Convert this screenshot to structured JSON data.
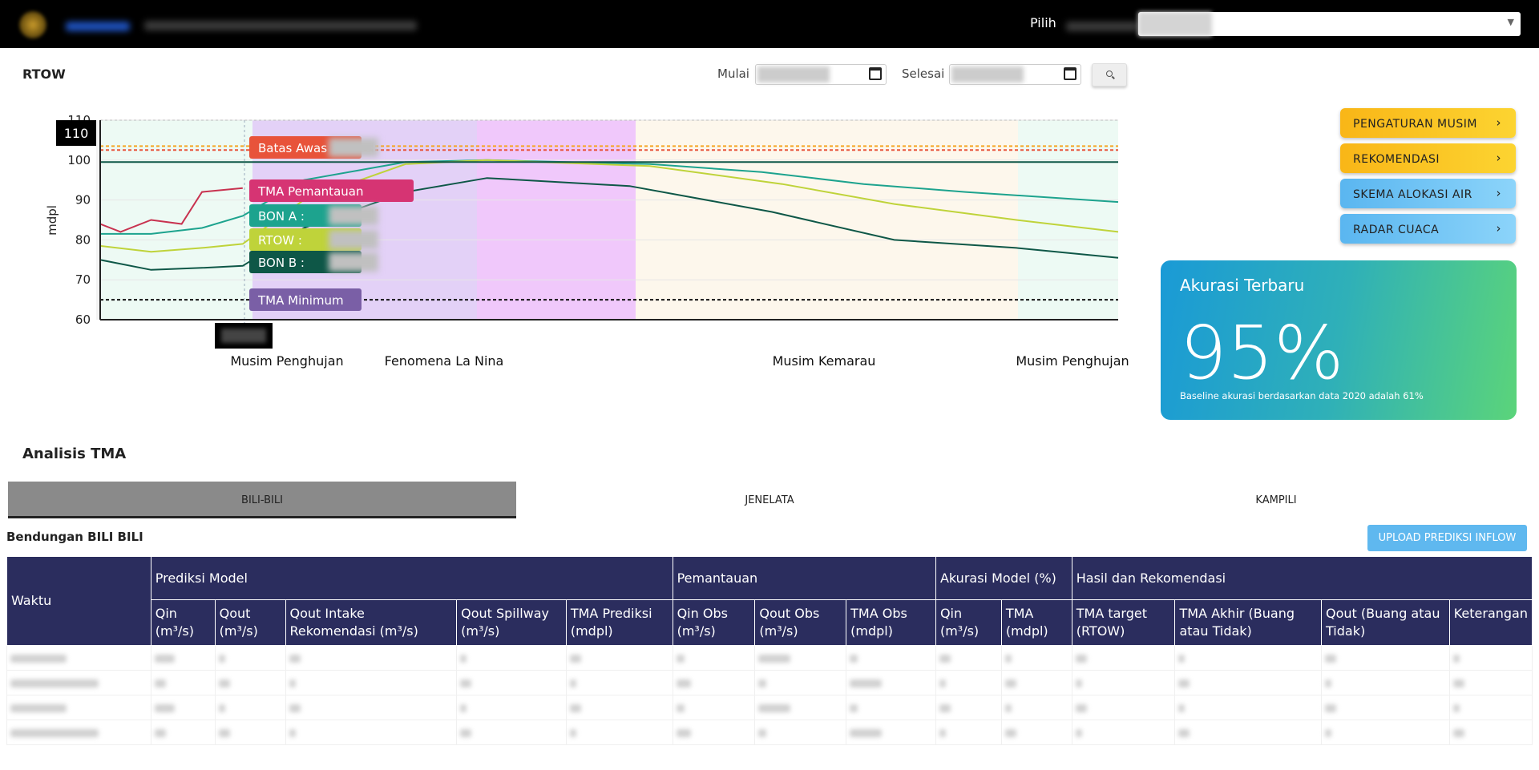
{
  "topbar": {
    "pilih_label": "Pilih"
  },
  "filter": {
    "title": "RTOW",
    "mulai_label": "Mulai",
    "selesai_label": "Selesai"
  },
  "chart_data": {
    "type": "line",
    "ylabel": "mdpl",
    "ylim": [
      60,
      110
    ],
    "y_ticks": [
      "110",
      "100",
      "90",
      "80",
      "70",
      "60"
    ],
    "hover_value": "110",
    "season_labels": [
      "Musim Penghujan",
      "Fenomena La Nina",
      "Musim Kemarau",
      "Musim Penghujan"
    ],
    "tooltips": [
      {
        "label": "Batas Awas",
        "color": "#e8533a"
      },
      {
        "label": "TMA Pemantauan",
        "color": "#d63473"
      },
      {
        "label": "BON A : ",
        "color": "#1da38e"
      },
      {
        "label": "RTOW : ",
        "color": "#bfd33a"
      },
      {
        "label": "BON B : ",
        "color": "#0e5747"
      },
      {
        "label": "TMA Minimum",
        "color": "#7a5fa6"
      }
    ],
    "series": [
      {
        "color": "#c8324f",
        "x": [
          0,
          0.02,
          0.05,
          0.08,
          0.1,
          0.14
        ],
        "values": [
          84,
          82,
          85,
          84,
          92,
          93
        ]
      },
      {
        "color": "#1da38e",
        "x": [
          0,
          0.05,
          0.1,
          0.14,
          0.2,
          0.3,
          0.38,
          0.54,
          0.65,
          0.75,
          0.85,
          1.0
        ],
        "values": [
          81.5,
          81.5,
          83,
          86,
          95,
          99.5,
          100,
          99,
          97,
          94,
          92,
          89.5
        ]
      },
      {
        "color": "#bfd33a",
        "x": [
          0,
          0.05,
          0.1,
          0.14,
          0.2,
          0.3,
          0.38,
          0.54,
          0.67,
          0.78,
          0.9,
          1.0
        ],
        "values": [
          78.5,
          77,
          78,
          79,
          90,
          99,
          100,
          98.5,
          94,
          89,
          85,
          82
        ]
      },
      {
        "color": "#0e5747",
        "x": [
          0,
          0.05,
          0.1,
          0.14,
          0.2,
          0.3,
          0.38,
          0.52,
          0.66,
          0.78,
          0.9,
          1.0
        ],
        "values": [
          75,
          72.5,
          73,
          73.5,
          83,
          92,
          95.5,
          93.5,
          87,
          80,
          78,
          75.5
        ]
      },
      {
        "color": "#111111",
        "dashed": true,
        "x": [
          0,
          1
        ],
        "values": [
          65,
          65
        ]
      },
      {
        "color": "#e8533a",
        "dashed": true,
        "x": [
          0,
          1
        ],
        "values": [
          102.5,
          102.5
        ]
      },
      {
        "color": "#f5a623",
        "dashed": true,
        "x": [
          0,
          1
        ],
        "values": [
          103.5,
          103.5
        ]
      },
      {
        "color": "#0e5747",
        "x": [
          0,
          1
        ],
        "values": [
          99.5,
          99.5
        ]
      }
    ]
  },
  "sidebar": {
    "buttons": [
      {
        "label": "PENGATURAN MUSIM",
        "chevron": "›"
      },
      {
        "label": "REKOMENDASI",
        "chevron": "›"
      },
      {
        "label": "SKEMA ALOKASI AIR",
        "chevron": "›"
      },
      {
        "label": "RADAR CUACA",
        "chevron": "›"
      }
    ]
  },
  "akurasi": {
    "title": "Akurasi Terbaru",
    "value": "95%",
    "note": "Baseline akurasi berdasarkan data 2020 adalah 61%"
  },
  "analisis": {
    "title": "Analisis TMA",
    "tabs": [
      "BILI-BILI",
      "JENELATA",
      "KAMPILI"
    ],
    "dam_title": "Bendungan BILI BILI",
    "upload_label": "UPLOAD PREDIKSI INFLOW"
  },
  "table": {
    "waktu": "Waktu",
    "groups": [
      "Prediksi Model",
      "Pemantauan",
      "Akurasi Model (%)",
      "Hasil dan Rekomendasi"
    ],
    "columns": [
      "Qin (m³/s)",
      "Qout (m³/s)",
      "Qout Intake Rekomendasi (m³/s)",
      "Qout Spillway (m³/s)",
      "TMA Prediksi (mdpl)",
      "Qin Obs (m³/s)",
      "Qout Obs (m³/s)",
      "TMA Obs (mdpl)",
      "Qin (m³/s)",
      "TMA (mdpl)",
      "TMA target (RTOW)",
      "TMA Akhir (Buang atau Tidak)",
      "Qout (Buang atau Tidak)",
      "Keterangan"
    ]
  }
}
